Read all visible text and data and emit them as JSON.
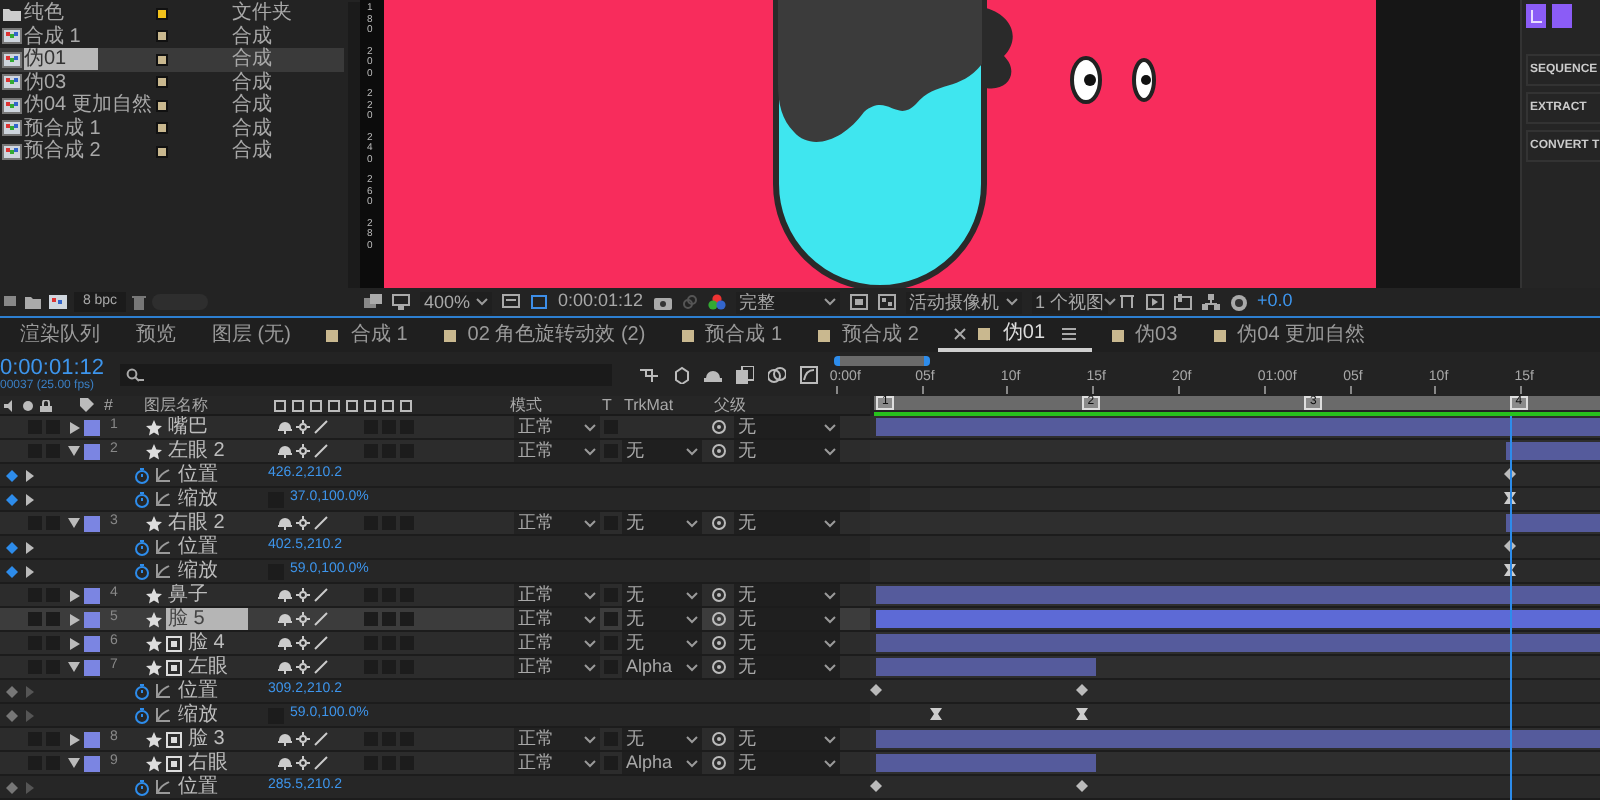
{
  "project": {
    "items": [
      {
        "name": "纯色",
        "type": "文件夹",
        "kind": "folder",
        "color": "#f2c21b",
        "selected": false
      },
      {
        "name": "合成 1",
        "type": "合成",
        "kind": "comp",
        "color": "#c9b88f",
        "selected": false
      },
      {
        "name": "伪01",
        "type": "合成",
        "kind": "comp",
        "color": "#c9b88f",
        "selected": true
      },
      {
        "name": "伪03",
        "type": "合成",
        "kind": "comp",
        "color": "#c9b88f",
        "selected": false
      },
      {
        "name": "伪04 更加自然",
        "type": "合成",
        "kind": "comp",
        "color": "#c9b88f",
        "selected": false
      },
      {
        "name": "预合成 1",
        "type": "合成",
        "kind": "comp",
        "color": "#c9b88f",
        "selected": false
      },
      {
        "name": "预合成 2",
        "type": "合成",
        "kind": "comp",
        "color": "#c9b88f",
        "selected": false
      }
    ],
    "bpc": "8 bpc"
  },
  "viewer": {
    "ruler": [
      "180",
      "200",
      "220",
      "240",
      "260",
      "280"
    ],
    "toolbar": {
      "zoom": "400%",
      "timecode": "0:00:01:12",
      "resolution": "完整",
      "camera": "活动摄像机",
      "views": "1 个视图",
      "exposure": "+0.0"
    }
  },
  "side_panel": {
    "buttons": [
      "SEQUENCE",
      "EXTRACT",
      "CONVERT T"
    ]
  },
  "tabs": [
    {
      "label": "渲染队列",
      "kind": "panel",
      "selected": false
    },
    {
      "label": "预览",
      "kind": "panel",
      "selected": false
    },
    {
      "label": "图层 (无)",
      "kind": "panel",
      "selected": false
    },
    {
      "label": "合成 1",
      "kind": "comp",
      "selected": false
    },
    {
      "label": "02 角色旋转动效 (2)",
      "kind": "comp",
      "selected": false
    },
    {
      "label": "预合成 1",
      "kind": "comp",
      "selected": false
    },
    {
      "label": "预合成 2",
      "kind": "comp",
      "selected": false
    },
    {
      "label": "伪01",
      "kind": "comp",
      "selected": true
    },
    {
      "label": "伪03",
      "kind": "comp",
      "selected": false
    },
    {
      "label": "伪04 更加自然",
      "kind": "comp",
      "selected": false
    }
  ],
  "timeline": {
    "timecode": "0:00:01:12",
    "frame_info": "00037 (25.00 fps)",
    "columns": {
      "number": "#",
      "name": "图层名称",
      "mode": "模式",
      "t": "T",
      "trkmat": "TrkMat",
      "parent": "父级"
    },
    "ruler": [
      "0:00f",
      "05f",
      "10f",
      "15f",
      "20f",
      "01:00f",
      "05f",
      "10f",
      "15f"
    ],
    "markers": [
      "1",
      "2",
      "3",
      "4"
    ],
    "rows": [
      {
        "kind": "layer",
        "number": "1",
        "name": "嘴巴",
        "precomp": false,
        "expanded": false,
        "selected": false,
        "mode": "正常",
        "parent": "无",
        "bar": {
          "kind": "full"
        }
      },
      {
        "kind": "layer",
        "number": "2",
        "name": "左眼 2",
        "precomp": false,
        "expanded": true,
        "selected": false,
        "mode": "正常",
        "trkmat": "无",
        "parent": "无",
        "bar": {
          "kind": "tail"
        }
      },
      {
        "kind": "property",
        "name": "位置",
        "value": "426.2,210.2",
        "linked": false,
        "on_key": true,
        "keys_at_playhead": true,
        "hold": false
      },
      {
        "kind": "property",
        "name": "缩放",
        "value": "37.0,100.0%",
        "linked": true,
        "on_key": true,
        "keys_at_playhead": true,
        "hold": true
      },
      {
        "kind": "layer",
        "number": "3",
        "name": "右眼 2",
        "precomp": false,
        "expanded": true,
        "selected": false,
        "mode": "正常",
        "trkmat": "无",
        "parent": "无",
        "bar": {
          "kind": "tail"
        }
      },
      {
        "kind": "property",
        "name": "位置",
        "value": "402.5,210.2",
        "linked": false,
        "on_key": true,
        "keys_at_playhead": true,
        "hold": false
      },
      {
        "kind": "property",
        "name": "缩放",
        "value": "59.0,100.0%",
        "linked": true,
        "on_key": true,
        "keys_at_playhead": true,
        "hold": true
      },
      {
        "kind": "layer",
        "number": "4",
        "name": "鼻子",
        "precomp": false,
        "expanded": false,
        "selected": false,
        "mode": "正常",
        "trkmat": "无",
        "parent": "无",
        "bar": {
          "kind": "full"
        }
      },
      {
        "kind": "layer",
        "number": "5",
        "name": "脸 5",
        "precomp": false,
        "expanded": false,
        "selected": true,
        "mode": "正常",
        "trkmat": "无",
        "parent": "无",
        "bar": {
          "kind": "full"
        }
      },
      {
        "kind": "layer",
        "number": "6",
        "name": "脸 4",
        "precomp": true,
        "expanded": false,
        "selected": false,
        "mode": "正常",
        "trkmat": "无",
        "parent": "无",
        "bar": {
          "kind": "full"
        }
      },
      {
        "kind": "layer",
        "number": "7",
        "name": "左眼",
        "precomp": true,
        "expanded": true,
        "selected": false,
        "mode": "正常",
        "trkmat": "Alpha",
        "parent": "无",
        "bar": {
          "kind": "short"
        }
      },
      {
        "kind": "property",
        "name": "位置",
        "value": "309.2,210.2",
        "linked": false,
        "on_key": false,
        "keys_at_playhead": false,
        "hold": false
      },
      {
        "kind": "property",
        "name": "缩放",
        "value": "59.0,100.0%",
        "linked": true,
        "on_key": false,
        "keys_at_playhead": false,
        "hold": true
      },
      {
        "kind": "layer",
        "number": "8",
        "name": "脸 3",
        "precomp": true,
        "expanded": false,
        "selected": false,
        "mode": "正常",
        "trkmat": "无",
        "parent": "无",
        "bar": {
          "kind": "full"
        }
      },
      {
        "kind": "layer",
        "number": "9",
        "name": "右眼",
        "precomp": true,
        "expanded": true,
        "selected": false,
        "mode": "正常",
        "trkmat": "Alpha",
        "parent": "无",
        "bar": {
          "kind": "short"
        }
      },
      {
        "kind": "property",
        "name": "位置",
        "value": "285.5,210.2",
        "linked": false,
        "on_key": false,
        "keys_at_playhead": false,
        "hold": false
      }
    ]
  }
}
